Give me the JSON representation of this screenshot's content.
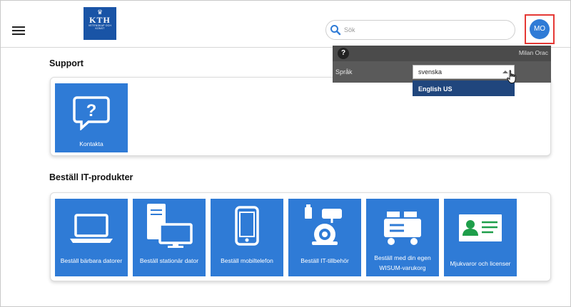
{
  "header": {
    "logo_text": "KTH",
    "logo_subtext": "VETENSKAP OCH KONST",
    "search_placeholder": "Sök",
    "avatar_initials": "MO"
  },
  "user_menu": {
    "user_name": "Milan Orac",
    "language_label": "Språk",
    "language_selected": "svenska",
    "language_option_highlighted": "English US"
  },
  "sections": {
    "support": {
      "title": "Support",
      "tiles": [
        {
          "label": "Kontakta",
          "icon": "chat-question-icon"
        }
      ]
    },
    "it_products": {
      "title": "Beställ IT-produkter",
      "tiles": [
        {
          "label": "Beställ bärbara datorer",
          "icon": "laptop-icon"
        },
        {
          "label": "Beställ stationär dator",
          "icon": "desktop-computer-icon"
        },
        {
          "label": "Beställ mobiltelefon",
          "icon": "mobile-phone-icon"
        },
        {
          "label": "Beställ IT-tillbehör",
          "icon": "accessories-icon"
        },
        {
          "label": "Beställ med din egen WISUM-varukorg",
          "icon": "cart-icon"
        },
        {
          "label": "Mjukvaror och licenser",
          "icon": "license-card-icon"
        }
      ]
    }
  },
  "colors": {
    "tile_blue": "#2f7bd6",
    "kth_blue": "#1954a6",
    "highlight_red": "#e53935",
    "option_dark_blue": "#20467d"
  }
}
